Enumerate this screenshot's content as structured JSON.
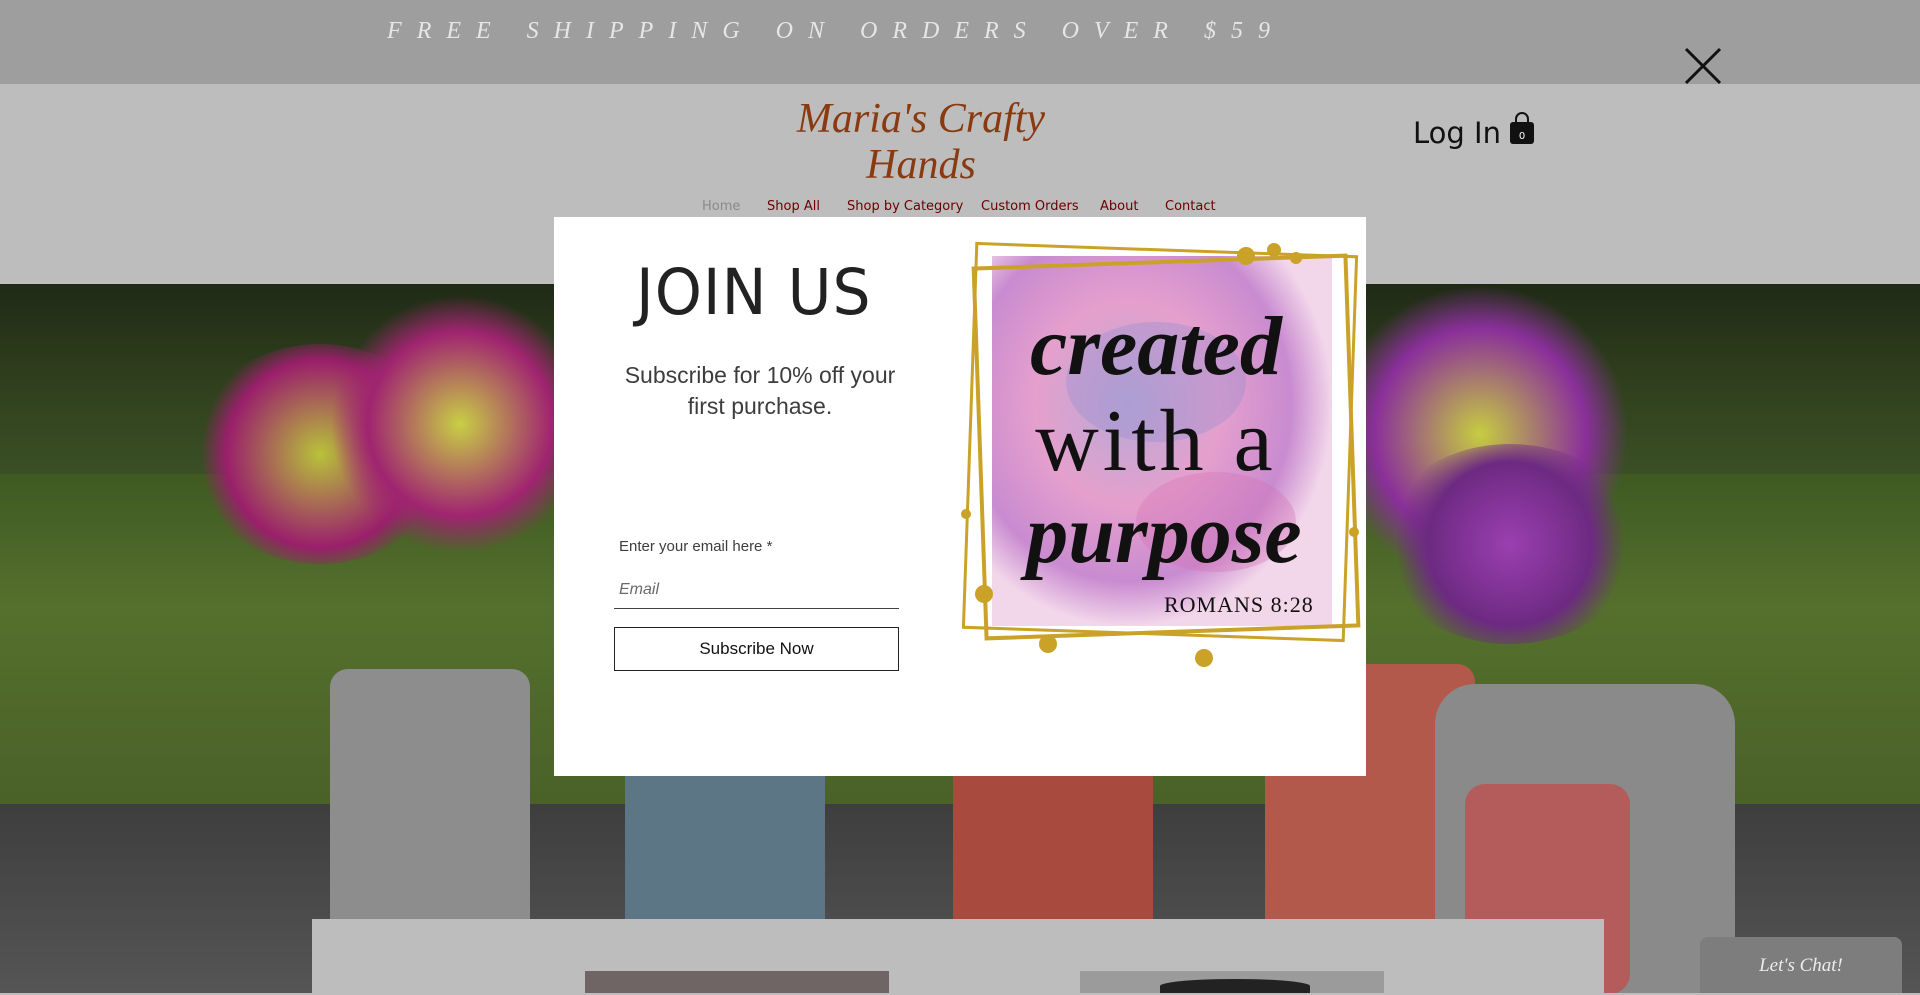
{
  "announcement": {
    "text": "FREE SHIPPING ON ORDERS OVER $59"
  },
  "header": {
    "logo_text_line1": "Maria's Crafty",
    "logo_text_line2": "Hands",
    "login_label": "Log In",
    "cart_count": "0"
  },
  "nav": {
    "items": [
      {
        "label": "Home"
      },
      {
        "label": "Shop All"
      },
      {
        "label": "Shop by Category"
      },
      {
        "label": "Custom Orders"
      },
      {
        "label": "About"
      },
      {
        "label": "Contact"
      }
    ]
  },
  "popup": {
    "title": "JOIN US",
    "subtitle": "Subscribe for 10% off your first purchase.",
    "email_label": "Enter your email here *",
    "email_placeholder": "Email",
    "email_value": "",
    "submit_label": "Subscribe Now",
    "art": {
      "line1": "created",
      "line2": "with a",
      "line3": "purpose",
      "verse": "ROMANS 8:28"
    }
  },
  "chat": {
    "label": "Let's Chat!"
  },
  "colors": {
    "nav_text": "#6b0000",
    "logo": "#8a3a10",
    "gold_frame": "#c9a227",
    "overlay": "#bdbdbd"
  },
  "icons": {
    "close": "close-icon",
    "cart": "shopping-bag-icon"
  }
}
